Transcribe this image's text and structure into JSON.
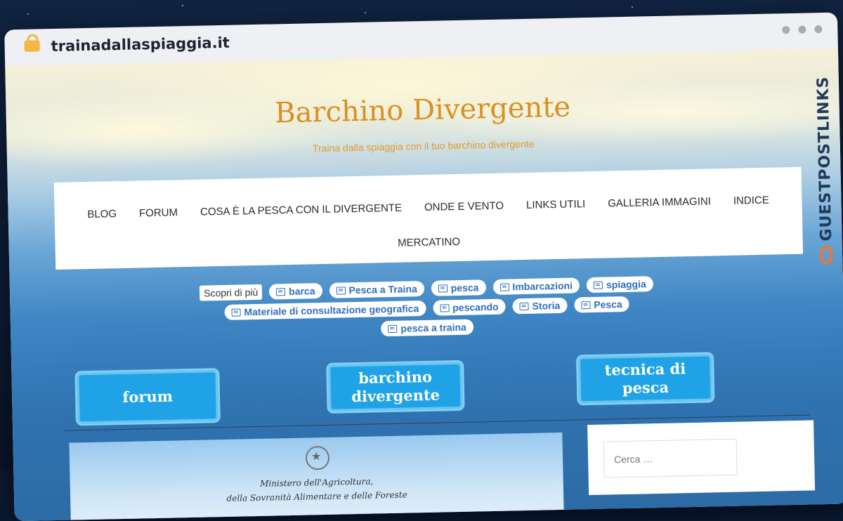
{
  "browser": {
    "url": "trainadallaspiaggia.it"
  },
  "site": {
    "title": "Barchino Divergente",
    "tagline": "Traina dalla spiaggia con il tuo barchino divergente"
  },
  "nav": {
    "row1": [
      "BLOG",
      "FORUM",
      "COSA È LA PESCA CON IL DIVERGENTE",
      "ONDE E VENTO",
      "LINKS UTILI",
      "GALLERIA IMMAGINI",
      "INDICE"
    ],
    "row2": [
      "MERCATINO"
    ]
  },
  "tags": {
    "label": "Scopri di più",
    "row1": [
      "barca",
      "Pesca a Traina",
      "pesca",
      "Imbarcazioni",
      "spiaggia"
    ],
    "row2": [
      "Materiale di consultazione geografica",
      "pescando",
      "Storia",
      "Pesca"
    ],
    "row3": [
      "pesca a traina"
    ]
  },
  "buttons": {
    "forum": "forum",
    "barchino": "barchino divergente",
    "tecnica": "tecnica di pesca"
  },
  "post": {
    "ministry_line1": "Ministero dell'Agricoltura,",
    "ministry_line2": "della Sovranità Alimentare e delle Foreste"
  },
  "sidebar": {
    "search_placeholder": "Cerca …"
  },
  "watermark": {
    "text": "GUESTPOSTLINKS"
  },
  "colors": {
    "title": "#d9901f",
    "button": "#1fa3e6",
    "tag_text": "#2f6fbf"
  }
}
